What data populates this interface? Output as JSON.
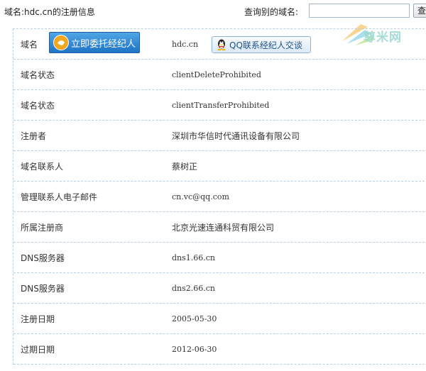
{
  "header": {
    "title": "域名:hdc.cn的注册信息",
    "search_label": "查询别的域名:",
    "search_value": "",
    "search_button": "查询"
  },
  "watermark": {
    "text": "尊米网"
  },
  "buttons": {
    "broker": "立即委托经纪人",
    "qq": "QQ联系经纪人交谈"
  },
  "rows": [
    {
      "label": "域名",
      "value": "hdc.cn"
    },
    {
      "label": "域名状态",
      "value": "clientDeleteProhibited"
    },
    {
      "label": "域名状态",
      "value": "clientTransferProhibited"
    },
    {
      "label": "注册者",
      "value": "深圳市华信时代通讯设备有限公司"
    },
    {
      "label": "域名联系人",
      "value": "蔡树正"
    },
    {
      "label": "管理联系人电子邮件",
      "value": "cn.vc@qq.com"
    },
    {
      "label": "所属注册商",
      "value": "北京光速连通科贸有限公司"
    },
    {
      "label": "DNS服务器",
      "value": "dns1.66.cn"
    },
    {
      "label": "DNS服务器",
      "value": "dns2.66.cn"
    },
    {
      "label": "注册日期",
      "value": "2005-05-30"
    },
    {
      "label": "过期日期",
      "value": "2012-06-30"
    }
  ],
  "colors": {
    "border": "#b9cfe2",
    "broker_button": "#1f73c6",
    "qq_text": "#1d4f8a",
    "watermark": "#9ed9d2"
  }
}
